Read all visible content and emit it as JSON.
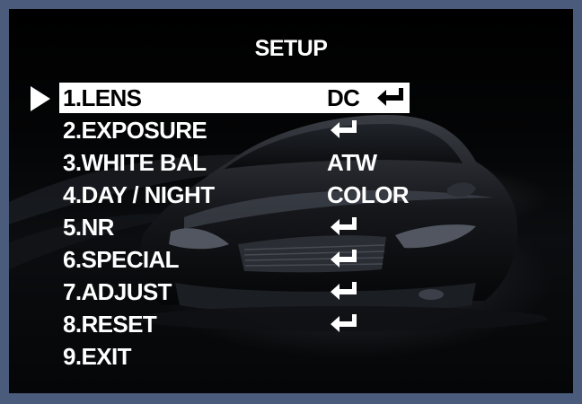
{
  "menu": {
    "title": "SETUP",
    "items": [
      {
        "label": "1.LENS",
        "value": "DC",
        "enter": true,
        "selected": true
      },
      {
        "label": "2.EXPOSURE",
        "value": "",
        "enter": true,
        "selected": false
      },
      {
        "label": "3.WHITE BAL",
        "value": "ATW",
        "enter": false,
        "selected": false
      },
      {
        "label": "4.DAY / NIGHT",
        "value": "COLOR",
        "enter": false,
        "selected": false
      },
      {
        "label": "5.NR",
        "value": "",
        "enter": true,
        "selected": false
      },
      {
        "label": "6.SPECIAL",
        "value": "",
        "enter": true,
        "selected": false
      },
      {
        "label": "7.ADJUST",
        "value": "",
        "enter": true,
        "selected": false
      },
      {
        "label": "8.RESET",
        "value": "",
        "enter": true,
        "selected": false
      },
      {
        "label": "9.EXIT",
        "value": "",
        "enter": false,
        "selected": false
      }
    ]
  },
  "icons": {
    "cursor": "triangle-right-icon",
    "enter": "enter-return-icon"
  },
  "colors": {
    "frame": "#4b5b7c",
    "background": "#000000",
    "text": "#ffffff",
    "highlight": "#ffffff",
    "highlight_text": "#000000"
  }
}
